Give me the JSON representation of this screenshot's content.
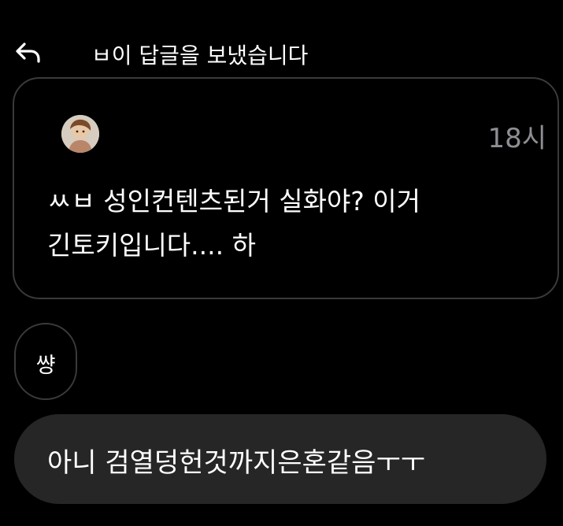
{
  "header": {
    "reply_icon": "reply-arrow-icon",
    "reply_text": "ㅂ이 답글을 보냈습니다"
  },
  "quoted_message": {
    "avatar": "user-avatar",
    "time": "18시",
    "text": "ㅆㅂ 성인컨텐츠된거 실화야? 이거\n긴토키입니다.... 하"
  },
  "reaction": {
    "text": "썅"
  },
  "sent_message": {
    "text": "아니 검열덩헌것까지은혼같음ㅜㅜ"
  },
  "colors": {
    "background": "#000000",
    "card_border": "#3a3a3d",
    "bubble_background": "#262626",
    "time_text": "#8e8e93",
    "text": "#ffffff"
  }
}
